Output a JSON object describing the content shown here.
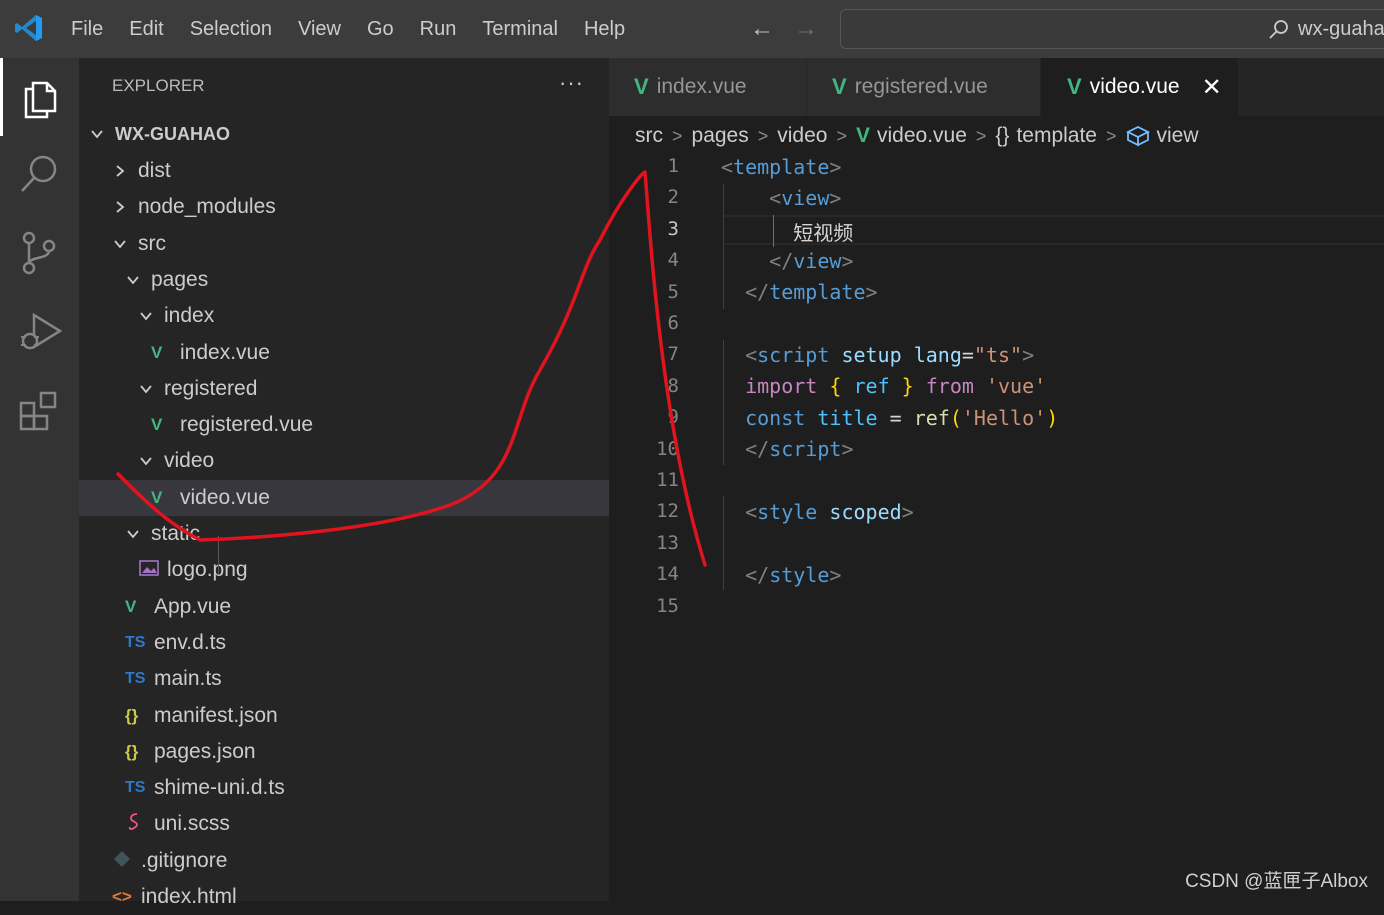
{
  "menu": [
    "File",
    "Edit",
    "Selection",
    "View",
    "Go",
    "Run",
    "Terminal",
    "Help"
  ],
  "search": {
    "text": "wx-guaha"
  },
  "explorer": {
    "title": "EXPLORER",
    "more": "···"
  },
  "tree": [
    {
      "label": "WX-GUAHAO",
      "type": "root",
      "chev": "down"
    },
    {
      "label": "dist",
      "type": "folder",
      "chev": "right"
    },
    {
      "label": "node_modules",
      "type": "folder",
      "chev": "right"
    },
    {
      "label": "src",
      "type": "folder",
      "chev": "down"
    },
    {
      "label": "pages",
      "type": "folder",
      "chev": "down"
    },
    {
      "label": "index",
      "type": "folder",
      "chev": "down"
    },
    {
      "label": "index.vue",
      "type": "vue"
    },
    {
      "label": "registered",
      "type": "folder",
      "chev": "down"
    },
    {
      "label": "registered.vue",
      "type": "vue"
    },
    {
      "label": "video",
      "type": "folder",
      "chev": "down"
    },
    {
      "label": "video.vue",
      "type": "vue",
      "selected": true
    },
    {
      "label": "static",
      "type": "folder",
      "chev": "down"
    },
    {
      "label": "logo.png",
      "type": "png"
    },
    {
      "label": "App.vue",
      "type": "vue"
    },
    {
      "label": "env.d.ts",
      "type": "ts"
    },
    {
      "label": "main.ts",
      "type": "ts"
    },
    {
      "label": "manifest.json",
      "type": "json"
    },
    {
      "label": "pages.json",
      "type": "json"
    },
    {
      "label": "shime-uni.d.ts",
      "type": "ts"
    },
    {
      "label": "uni.scss",
      "type": "scss"
    },
    {
      "label": ".gitignore",
      "type": "git"
    },
    {
      "label": "index.html",
      "type": "html"
    }
  ],
  "icons": {
    "vue": "V",
    "ts": "TS",
    "json": "{}",
    "scss": "scss-icon",
    "git": "git-icon",
    "html": "<>",
    "png": "image-icon"
  },
  "tabs": [
    {
      "label": "index.vue",
      "active": false
    },
    {
      "label": "registered.vue",
      "active": false
    },
    {
      "label": "video.vue",
      "active": true,
      "close": "✕"
    }
  ],
  "breadcrumb": {
    "src": "src",
    "pages": "pages",
    "video": "video",
    "file": "video.vue",
    "template": "template",
    "view": "view"
  },
  "editor": {
    "current_line": 3,
    "line_numbers": [
      "1",
      "2",
      "3",
      "4",
      "5",
      "6",
      "7",
      "8",
      "9",
      "10",
      "11",
      "12",
      "13",
      "14",
      "15"
    ]
  },
  "watermark": "CSDN @蓝匣子Albox",
  "colors": {
    "vue_green": "#41b883",
    "ts_blue": "#3178c6",
    "annotation_red": "#e0141e",
    "keyword_blue": "#569cd6"
  }
}
